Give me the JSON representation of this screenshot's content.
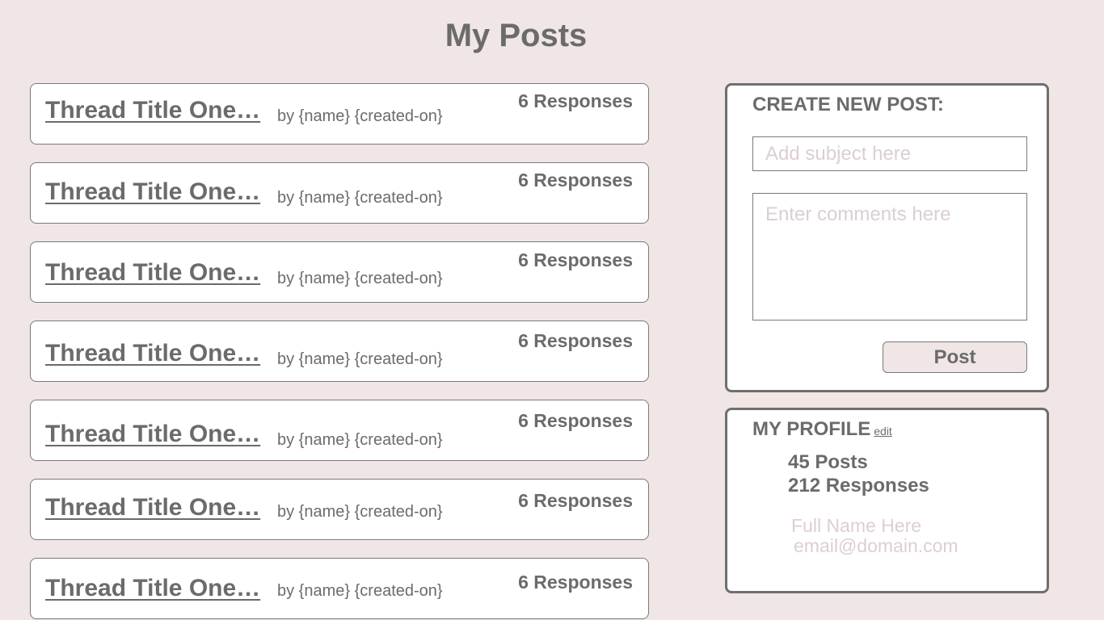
{
  "page": {
    "title": "My Posts"
  },
  "threads": [
    {
      "title": "Thread Title One…",
      "meta": "by {name} {created-on}",
      "responses": "6 Responses"
    },
    {
      "title": "Thread Title One…",
      "meta": "by {name} {created-on}",
      "responses": "6 Responses"
    },
    {
      "title": "Thread Title One…",
      "meta": "by {name} {created-on}",
      "responses": "6 Responses"
    },
    {
      "title": "Thread Title One…",
      "meta": "by {name} {created-on}",
      "responses": "6 Responses"
    },
    {
      "title": "Thread Title One…",
      "meta": "by {name} {created-on}",
      "responses": "6 Responses"
    },
    {
      "title": "Thread Title One…",
      "meta": "by {name} {created-on}",
      "responses": "6 Responses"
    },
    {
      "title": "Thread Title One…",
      "meta": "by {name} {created-on}",
      "responses": "6 Responses"
    }
  ],
  "create_post": {
    "heading": "CREATE NEW POST:",
    "subject_placeholder": "Add subject here",
    "comments_placeholder": "Enter comments here",
    "post_label": "Post"
  },
  "profile": {
    "heading": "MY PROFILE",
    "edit_label": "edit",
    "posts": "45 Posts",
    "responses": "212 Responses",
    "full_name": "Full Name Here",
    "email": "email@domain.com"
  },
  "colors": {
    "background": "#efe6e5",
    "text": "#6b6b6b",
    "placeholder": "#dccfd0",
    "border": "#6f6f6f"
  }
}
